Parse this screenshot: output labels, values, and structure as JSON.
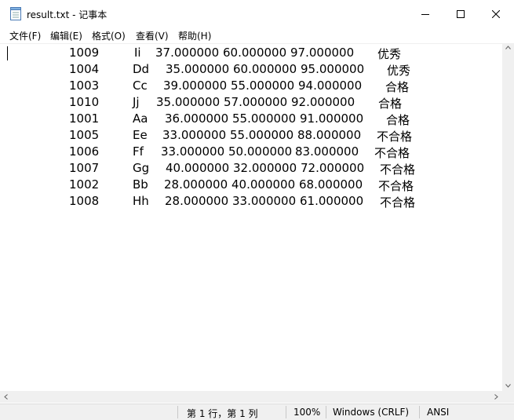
{
  "window": {
    "title": "result.txt - 记事本",
    "controls": {
      "minimize": "minimize-icon",
      "maximize": "maximize-icon",
      "close": "close-icon"
    }
  },
  "menu": {
    "file": "文件(F)",
    "edit": "编辑(E)",
    "format": "格式(O)",
    "view": "查看(V)",
    "help": "帮助(H)"
  },
  "rows": [
    {
      "id": "1009",
      "name": "Ii",
      "s1": "37.000000",
      "s2": "60.000000",
      "s3": "97.000000",
      "grade": "优秀"
    },
    {
      "id": "1004",
      "name": "Dd",
      "s1": "35.000000",
      "s2": "60.000000",
      "s3": "95.000000",
      "grade": "优秀"
    },
    {
      "id": "1003",
      "name": "Cc",
      "s1": "39.000000",
      "s2": "55.000000",
      "s3": "94.000000",
      "grade": "合格"
    },
    {
      "id": "1010",
      "name": "Jj",
      "s1": "35.000000",
      "s2": "57.000000",
      "s3": "92.000000",
      "grade": "合格"
    },
    {
      "id": "1001",
      "name": "Aa",
      "s1": "36.000000",
      "s2": "55.000000",
      "s3": "91.000000",
      "grade": "合格"
    },
    {
      "id": "1005",
      "name": "Ee",
      "s1": "33.000000",
      "s2": "55.000000",
      "s3": "88.000000",
      "grade": "不合格"
    },
    {
      "id": "1006",
      "name": "Ff",
      "s1": "33.000000",
      "s2": "50.000000",
      "s3": "83.000000",
      "grade": "不合格"
    },
    {
      "id": "1007",
      "name": "Gg",
      "s1": "40.000000",
      "s2": "32.000000",
      "s3": "72.000000",
      "grade": "不合格"
    },
    {
      "id": "1002",
      "name": "Bb",
      "s1": "28.000000",
      "s2": "40.000000",
      "s3": "68.000000",
      "grade": "不合格"
    },
    {
      "id": "1008",
      "name": "Hh",
      "s1": "28.000000",
      "s2": "33.000000",
      "s3": "61.000000",
      "grade": "不合格"
    }
  ],
  "status": {
    "position": "第 1 行，第 1 列",
    "zoom": "100%",
    "line_ending": "Windows (CRLF)",
    "encoding": "ANSI"
  }
}
